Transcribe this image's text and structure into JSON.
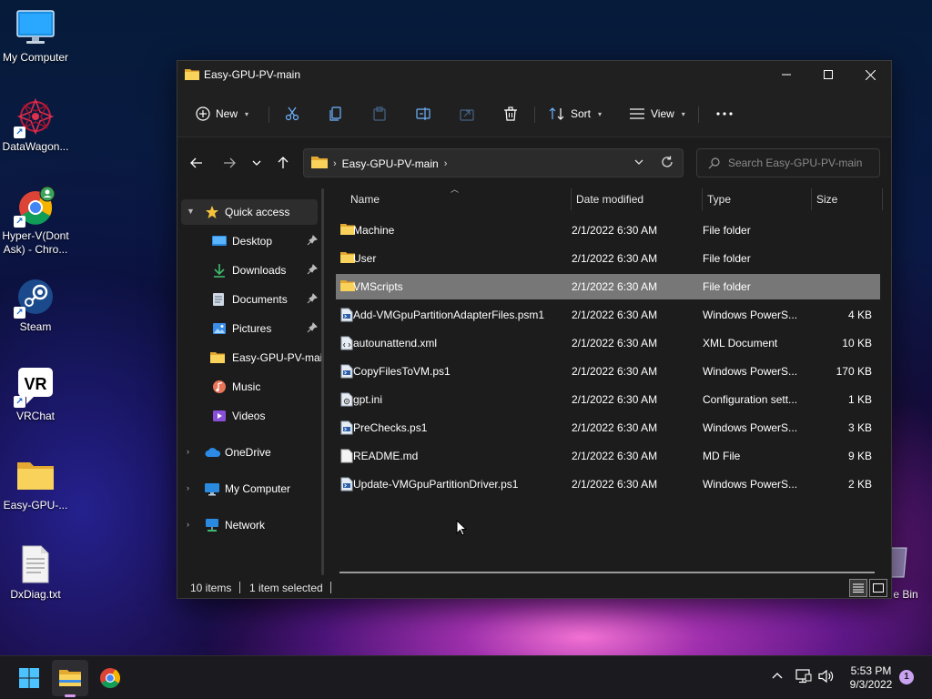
{
  "desktop": {
    "icons": [
      {
        "label": "My Computer",
        "icon": "monitor-icon"
      },
      {
        "label": "DataWagon...",
        "icon": "datawagon-logo-icon"
      },
      {
        "label": "Hyper-V(Dont Ask) - Chro...",
        "icon": "chrome-profile-icon"
      },
      {
        "label": "Steam",
        "icon": "steam-icon"
      },
      {
        "label": "VRChat",
        "icon": "vrchat-icon"
      },
      {
        "label": "Easy-GPU-...",
        "icon": "folder-icon"
      },
      {
        "label": "DxDiag.txt",
        "icon": "text-file-icon"
      }
    ],
    "recycle_bin_label": "e Bin"
  },
  "window": {
    "title": "Easy-GPU-PV-main",
    "commands": {
      "new_label": "New",
      "sort_label": "Sort",
      "view_label": "View"
    },
    "address": {
      "crumb": "Easy-GPU-PV-main"
    },
    "search": {
      "placeholder": "Search Easy-GPU-PV-main"
    },
    "nav": {
      "quick_access": "Quick access",
      "items": [
        {
          "label": "Desktop",
          "pinned": true
        },
        {
          "label": "Downloads",
          "pinned": true
        },
        {
          "label": "Documents",
          "pinned": true
        },
        {
          "label": "Pictures",
          "pinned": true
        },
        {
          "label": "Easy-GPU-PV-main",
          "pinned": false
        },
        {
          "label": "Music",
          "pinned": false
        },
        {
          "label": "Videos",
          "pinned": false
        }
      ],
      "onedrive": "OneDrive",
      "my_computer": "My Computer",
      "network": "Network"
    },
    "columns": {
      "name": "Name",
      "date": "Date modified",
      "type": "Type",
      "size": "Size"
    },
    "files": [
      {
        "name": "Machine",
        "date": "2/1/2022 6:30 AM",
        "type": "File folder",
        "size": "",
        "kind": "folder"
      },
      {
        "name": "User",
        "date": "2/1/2022 6:30 AM",
        "type": "File folder",
        "size": "",
        "kind": "folder"
      },
      {
        "name": "VMScripts",
        "date": "2/1/2022 6:30 AM",
        "type": "File folder",
        "size": "",
        "kind": "folder",
        "selected": true
      },
      {
        "name": "Add-VMGpuPartitionAdapterFiles.psm1",
        "date": "2/1/2022 6:30 AM",
        "type": "Windows PowerS...",
        "size": "4 KB",
        "kind": "ps"
      },
      {
        "name": "autounattend.xml",
        "date": "2/1/2022 6:30 AM",
        "type": "XML Document",
        "size": "10 KB",
        "kind": "xml"
      },
      {
        "name": "CopyFilesToVM.ps1",
        "date": "2/1/2022 6:30 AM",
        "type": "Windows PowerS...",
        "size": "170 KB",
        "kind": "ps"
      },
      {
        "name": "gpt.ini",
        "date": "2/1/2022 6:30 AM",
        "type": "Configuration sett...",
        "size": "1 KB",
        "kind": "ini"
      },
      {
        "name": "PreChecks.ps1",
        "date": "2/1/2022 6:30 AM",
        "type": "Windows PowerS...",
        "size": "3 KB",
        "kind": "ps"
      },
      {
        "name": "README.md",
        "date": "2/1/2022 6:30 AM",
        "type": "MD File",
        "size": "9 KB",
        "kind": "md"
      },
      {
        "name": "Update-VMGpuPartitionDriver.ps1",
        "date": "2/1/2022 6:30 AM",
        "type": "Windows PowerS...",
        "size": "2 KB",
        "kind": "ps"
      }
    ],
    "status": {
      "items": "10 items",
      "selected": "1 item selected"
    }
  },
  "taskbar": {
    "time": "5:53 PM",
    "date": "9/3/2022",
    "notification_count": "1"
  },
  "colors": {
    "selection": "#777777",
    "folder": "#f6c94e",
    "accent": "#c9a3f0"
  }
}
